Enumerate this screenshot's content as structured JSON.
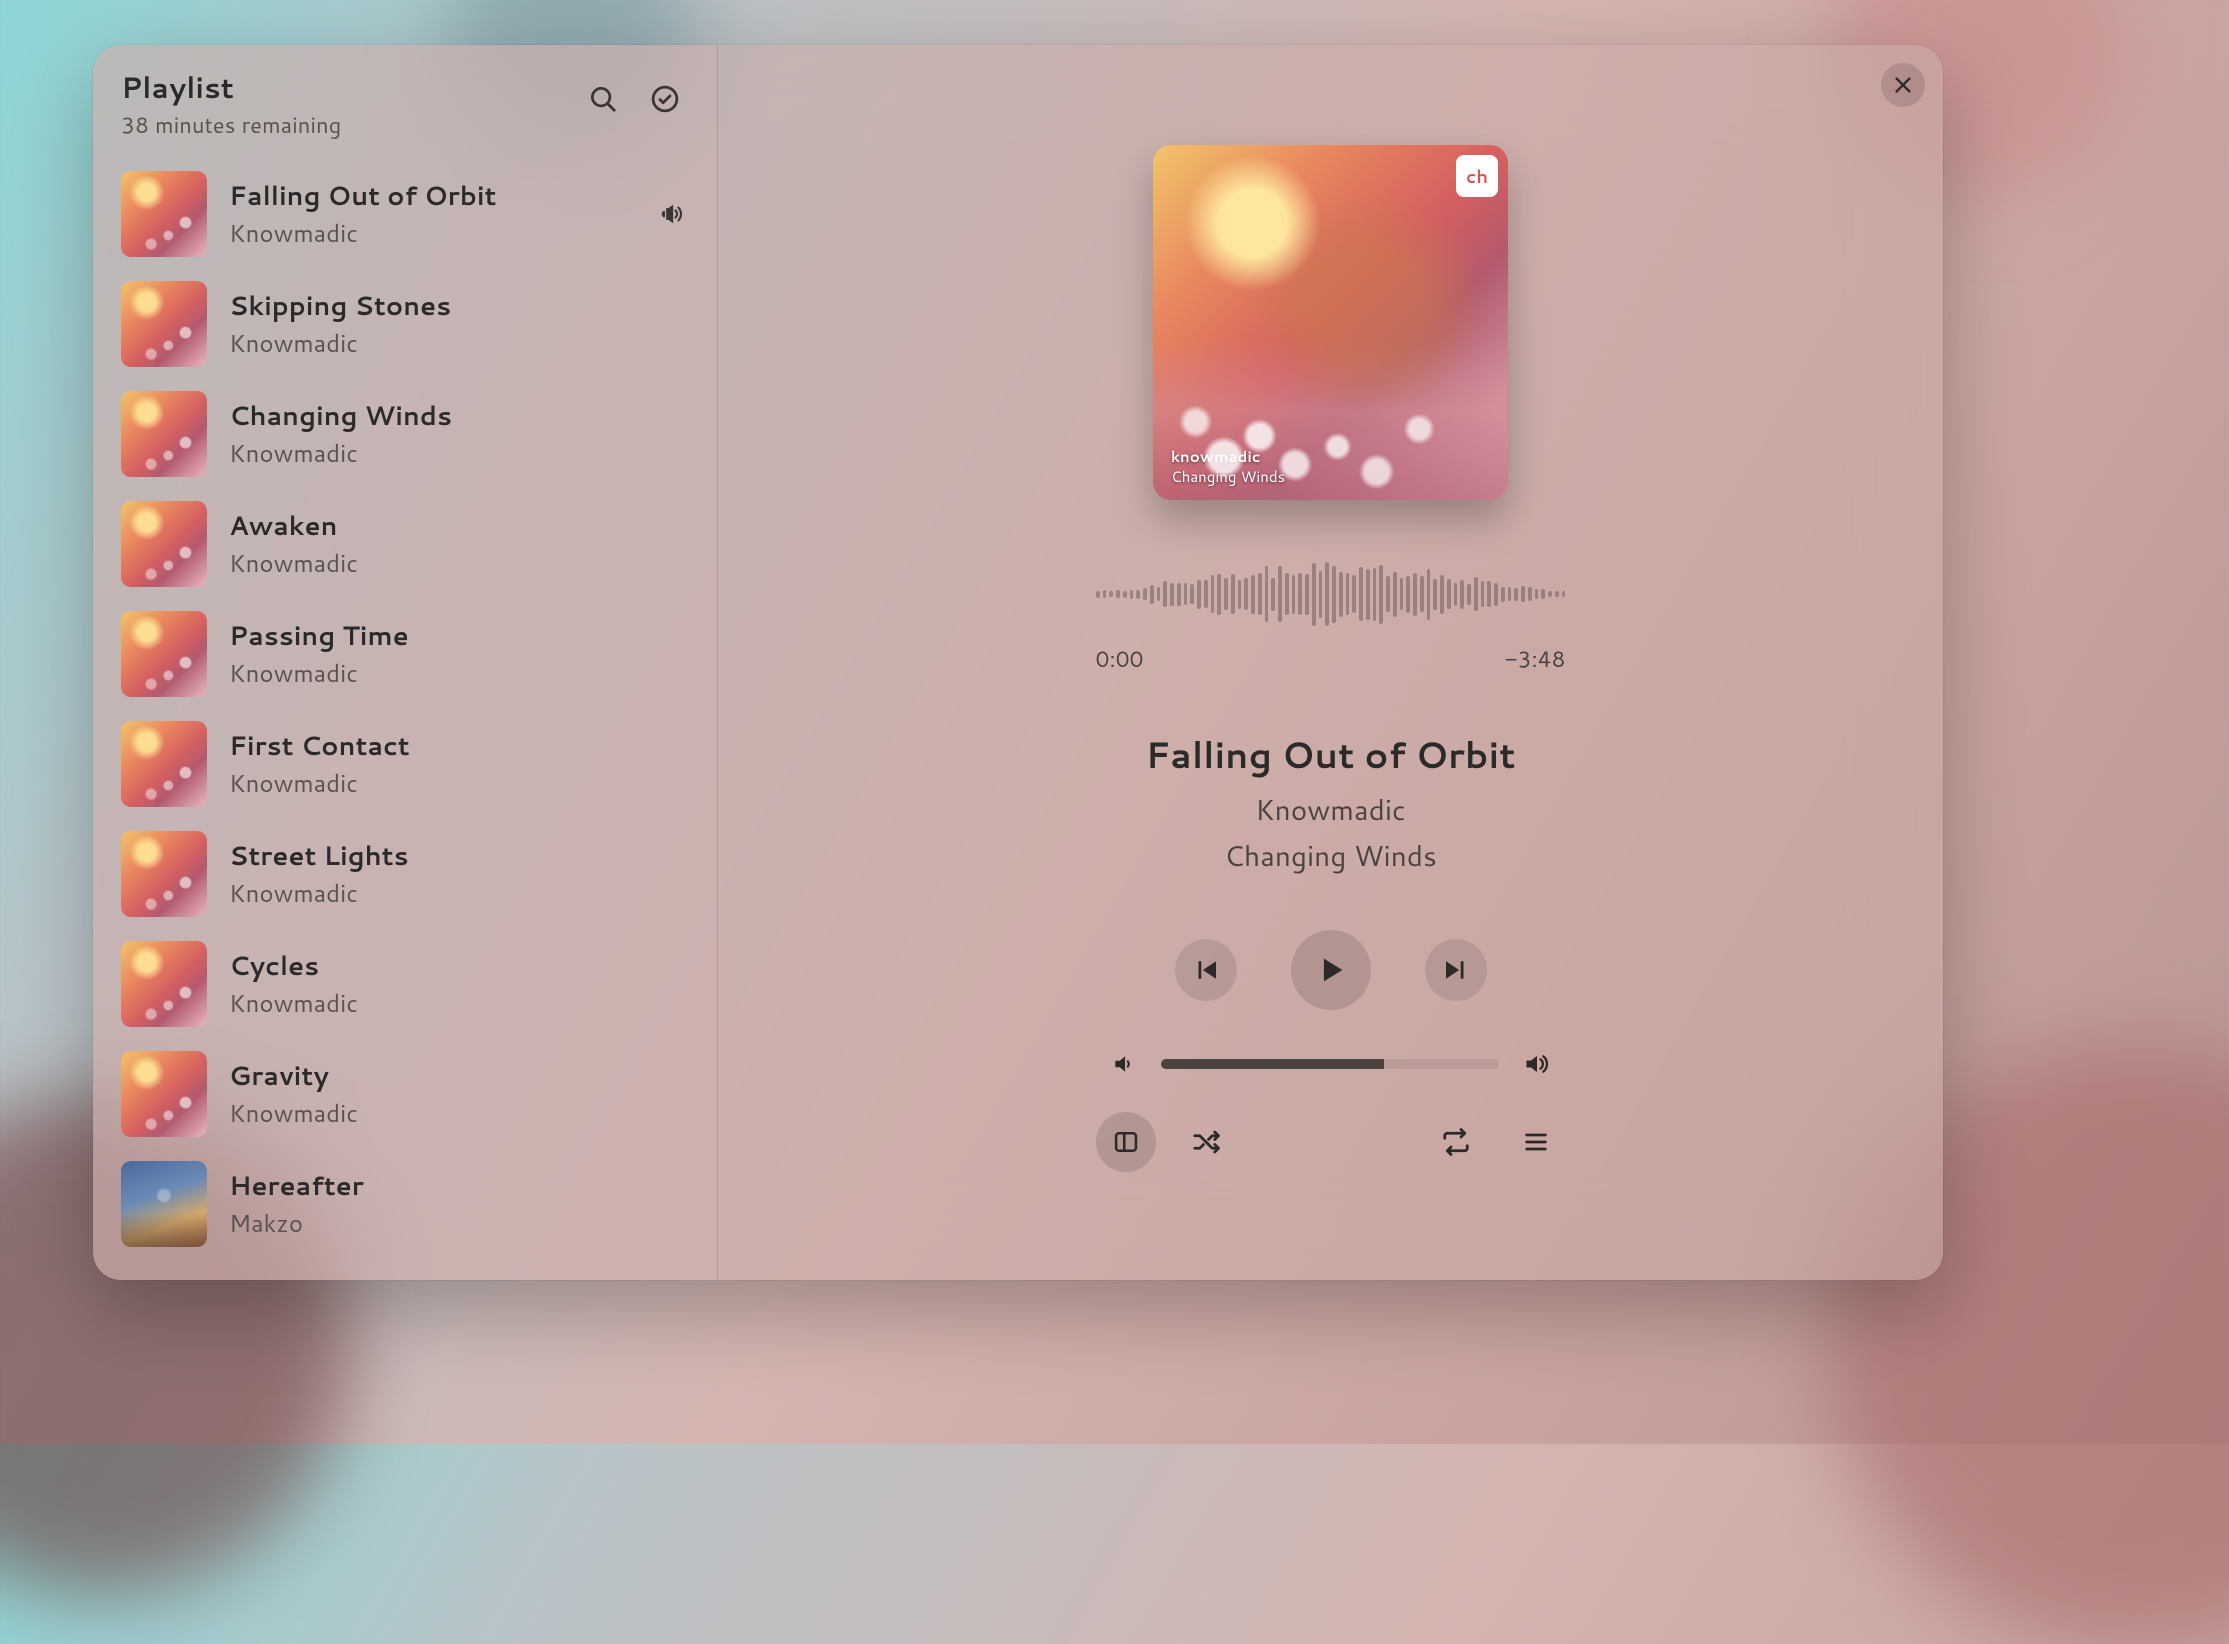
{
  "sidebar": {
    "title": "Playlist",
    "subtitle": "38 minutes remaining",
    "tracks": [
      {
        "title": "Falling Out of Orbit",
        "artist": "Knowmadic",
        "playing": true,
        "art": "default"
      },
      {
        "title": "Skipping Stones",
        "artist": "Knowmadic",
        "playing": false,
        "art": "default"
      },
      {
        "title": "Changing Winds",
        "artist": "Knowmadic",
        "playing": false,
        "art": "default"
      },
      {
        "title": "Awaken",
        "artist": "Knowmadic",
        "playing": false,
        "art": "default"
      },
      {
        "title": "Passing Time",
        "artist": "Knowmadic",
        "playing": false,
        "art": "default"
      },
      {
        "title": "First Contact",
        "artist": "Knowmadic",
        "playing": false,
        "art": "default"
      },
      {
        "title": "Street Lights",
        "artist": "Knowmadic",
        "playing": false,
        "art": "default"
      },
      {
        "title": "Cycles",
        "artist": "Knowmadic",
        "playing": false,
        "art": "default"
      },
      {
        "title": "Gravity",
        "artist": "Knowmadic",
        "playing": false,
        "art": "default"
      },
      {
        "title": "Hereafter",
        "artist": "Makzo",
        "playing": false,
        "art": "alt"
      }
    ]
  },
  "now_playing": {
    "title": "Falling Out of Orbit",
    "artist": "Knowmadic",
    "album": "Changing Winds",
    "elapsed": "0:00",
    "remaining": "−3:48",
    "cover_badge": "ch",
    "cover_caption_artist": "knowmadic",
    "cover_caption_album": "Changing Winds"
  },
  "volume": {
    "percent": 66
  }
}
